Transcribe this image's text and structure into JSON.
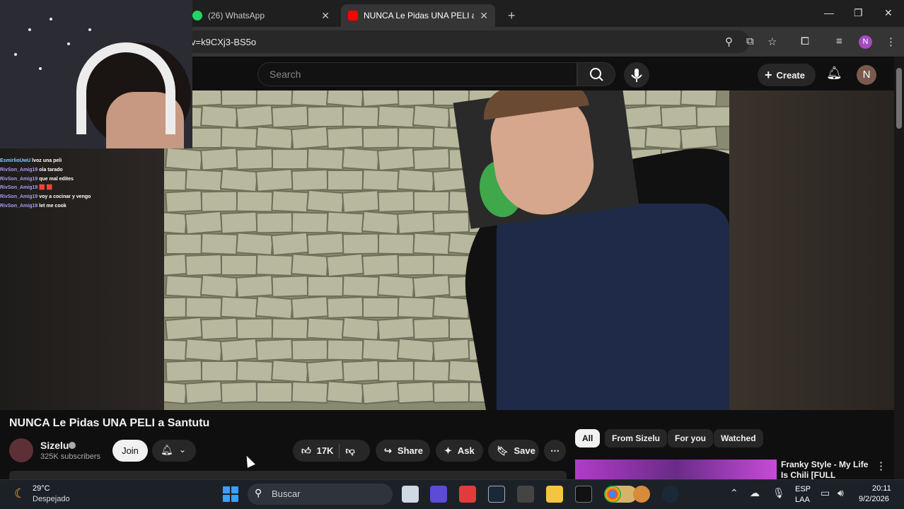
{
  "browser": {
    "tabs": [
      {
        "label": "(26) WhatsApp"
      },
      {
        "label": "NUNCA Le Pidas UNA PELI a Sa"
      }
    ],
    "new_tab": "+",
    "address": "v=k9CXj3-BS5o",
    "profile_initial": "N"
  },
  "youtube": {
    "search_placeholder": "Search",
    "create_label": "Create",
    "avatar_initial": "N"
  },
  "stream_chat": [
    {
      "user": "EsmirlioUwU",
      "msg": "lvoz una peli"
    },
    {
      "user": "RivSon_Amig19",
      "msg": "ola tarado"
    },
    {
      "user": "RivSon_Amig19",
      "msg": "que mal edites"
    },
    {
      "user": "RivSon_Amig19",
      "msg": "🟥 🟥"
    },
    {
      "user": "RivSon_Amig19",
      "msg": "voy a cocinar y vengo"
    },
    {
      "user": "RivSon_Amig19",
      "msg": "let me cook"
    }
  ],
  "video": {
    "title": "NUNCA Le Pidas UNA PELI a Santutu",
    "channel": "Sizelu",
    "subscribers": "325K subscribers",
    "join_label": "Join",
    "likes": "17K",
    "share_label": "Share",
    "ask_label": "Ask",
    "save_label": "Save"
  },
  "filters": [
    {
      "label": "All",
      "selected": true
    },
    {
      "label": "From Sizelu"
    },
    {
      "label": "For you"
    },
    {
      "label": "Watched"
    }
  ],
  "recommendation": {
    "title": "Franky Style - My Life Is Chili [FULL MIXTAPE]"
  },
  "taskbar": {
    "temperature": "29°C",
    "weather": "Despejado",
    "search_label": "Buscar",
    "lang1": "ESP",
    "lang2": "LAA",
    "time": "20:11",
    "date": "9/2/2026"
  },
  "colors": {
    "accent_selected_chip": "#f1f1f1",
    "yt_background": "#0f0f0f",
    "taskbar": "#1c2128"
  }
}
